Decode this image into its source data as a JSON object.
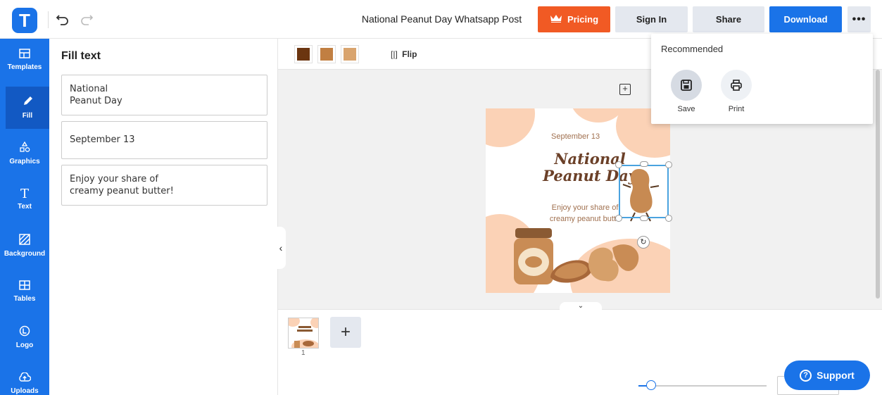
{
  "app": {
    "logo_letter": "T",
    "doc_title": "National Peanut Day Whatsapp Post"
  },
  "header": {
    "pricing_label": "Pricing",
    "signin_label": "Sign In",
    "share_label": "Share",
    "download_label": "Download",
    "more_label": "•••"
  },
  "sidebar": {
    "items": [
      {
        "label": "Templates",
        "icon": "template-icon"
      },
      {
        "label": "Fill",
        "icon": "pencil-icon"
      },
      {
        "label": "Graphics",
        "icon": "shapes-icon"
      },
      {
        "label": "Text",
        "icon": "text-icon"
      },
      {
        "label": "Background",
        "icon": "background-icon"
      },
      {
        "label": "Tables",
        "icon": "table-icon"
      },
      {
        "label": "Logo",
        "icon": "logo-icon"
      },
      {
        "label": "Uploads",
        "icon": "cloud-upload-icon"
      }
    ]
  },
  "panel": {
    "title": "Fill text",
    "fields": [
      "National\nPeanut Day",
      "September 13",
      "Enjoy your share of\ncreamy peanut butter!"
    ]
  },
  "toolbar": {
    "colors": [
      "#6b3510",
      "#c17f42",
      "#d9a46e"
    ],
    "flip_label": "Flip"
  },
  "design": {
    "date": "September 13",
    "title_line1": "National",
    "title_line2": "Peanut Day",
    "sub_line1": "Enjoy your share of",
    "sub_line2": "creamy peanut butte"
  },
  "pages": {
    "thumb_number": "1",
    "add_label": "+"
  },
  "dropdown": {
    "title": "Recommended",
    "items": [
      {
        "label": "Save",
        "icon": "save-icon"
      },
      {
        "label": "Print",
        "icon": "print-icon"
      }
    ]
  },
  "support": {
    "label": "Support"
  }
}
